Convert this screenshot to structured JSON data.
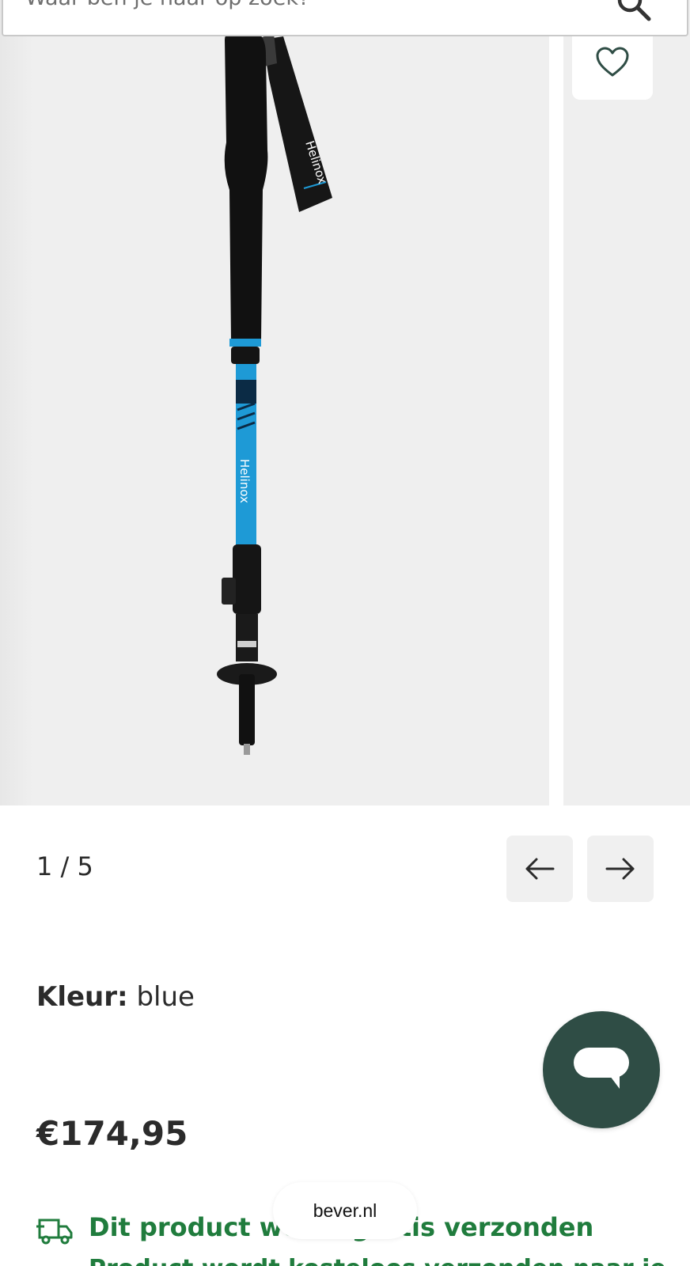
{
  "search": {
    "placeholder": "Waar ben je naar op zoek?"
  },
  "gallery": {
    "brand_on_product": "Helinox",
    "pager": "1 / 5",
    "product_color": "#1e9ad6"
  },
  "product": {
    "color_label": "Kleur:",
    "color_value": "blue",
    "price": "€174,95"
  },
  "shipping": {
    "text": "Dit product wordt gratis verzonden",
    "subtext": "Product wordt kosteloos verzonden naar je"
  },
  "browser": {
    "url": "bever.nl"
  },
  "icons": {
    "search": "search-icon",
    "wishlist": "heart-icon",
    "prev": "arrow-left-icon",
    "next": "arrow-right-icon",
    "chat": "chat-bubble-icon",
    "shipping": "truck-icon"
  },
  "colors": {
    "chat_bg": "#2f4d45",
    "shipping_green": "#207c3d"
  }
}
